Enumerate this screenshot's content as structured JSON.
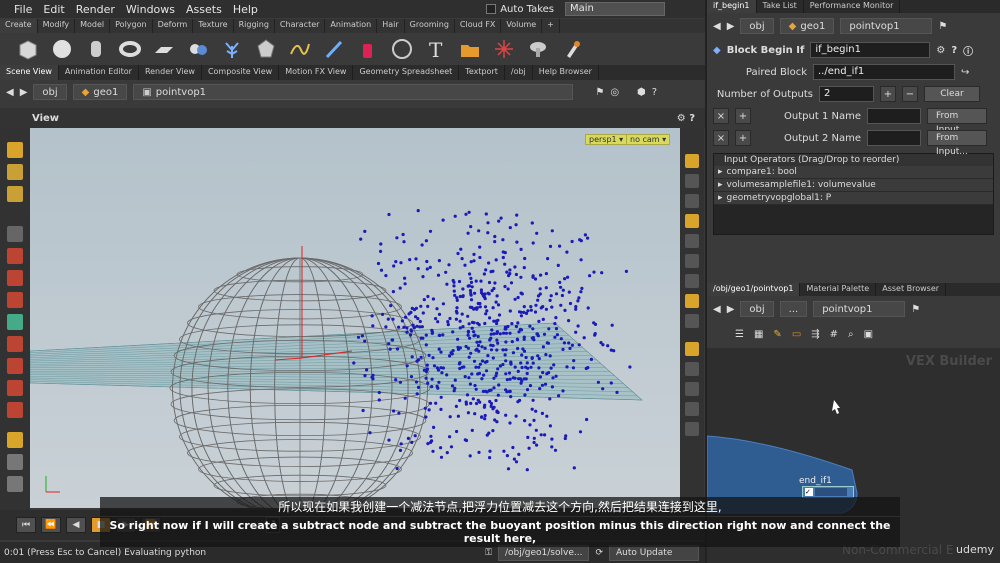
{
  "menubar": {
    "items": [
      "File",
      "Edit",
      "Render",
      "Windows",
      "Assets",
      "Help"
    ],
    "auto_takes": "Auto Takes",
    "desktop": "Main"
  },
  "shelf_tabs": [
    "Create",
    "Modify",
    "Model",
    "Polygon",
    "Deform",
    "Texture",
    "Rigging",
    "Character",
    "Animation",
    "Hair",
    "Grooming",
    "Cloud FX",
    "Volume",
    "+"
  ],
  "pane_tabs": [
    "Scene View",
    "Animation Editor",
    "Render View",
    "Composite View",
    "Motion FX View",
    "Geometry Spreadsheet",
    "Textport",
    "/obj",
    "Help Browser"
  ],
  "path": {
    "obj": "obj",
    "geo": "geo1",
    "node": "pointvop1"
  },
  "view": {
    "title": "View",
    "persp": "persp1",
    "cam": "no cam"
  },
  "status": {
    "text": "0:01 (Press Esc to Cancel) Evaluating python",
    "path": "/obj/geo1/solve...",
    "update": "Auto Update"
  },
  "frame": "1",
  "right_tabs": [
    "if_begin1",
    "Take List",
    "Performance Monitor"
  ],
  "right_path": {
    "obj": "obj",
    "geo": "geo1",
    "node": "pointvop1"
  },
  "params": {
    "node_type": "Block Begin If",
    "node_name": "if_begin1",
    "paired_label": "Paired Block",
    "paired_value": "../end_if1",
    "outputs_label": "Number of Outputs",
    "outputs_value": "2",
    "clear": "Clear",
    "output1_label": "Output 1 Name",
    "output2_label": "Output 2 Name",
    "from_input": "From Input...",
    "list_header": "Input Operators (Drag/Drop to reorder)",
    "inputs": [
      "compare1: bool",
      "volumesamplefile1: volumevalue",
      "geometryvopglobal1: P"
    ]
  },
  "net_tabs": [
    "/obj/geo1/pointvop1",
    "Material Palette",
    "Asset Browser"
  ],
  "net_path": {
    "obj": "obj",
    "dots": "...",
    "node": "pointvop1"
  },
  "network": {
    "watermark": "VEX Builder",
    "node_label": "end_if1",
    "nc": "Non-Commercial E"
  },
  "subtitle": {
    "zh": "所以现在如果我创建一个减法节点,把浮力位置减去这个方向,然后把结果连接到这里,",
    "en": "So right now if I will create a subtract node and subtract the buoyant position minus this direction right now and connect the result here,"
  },
  "brand": "udemy"
}
